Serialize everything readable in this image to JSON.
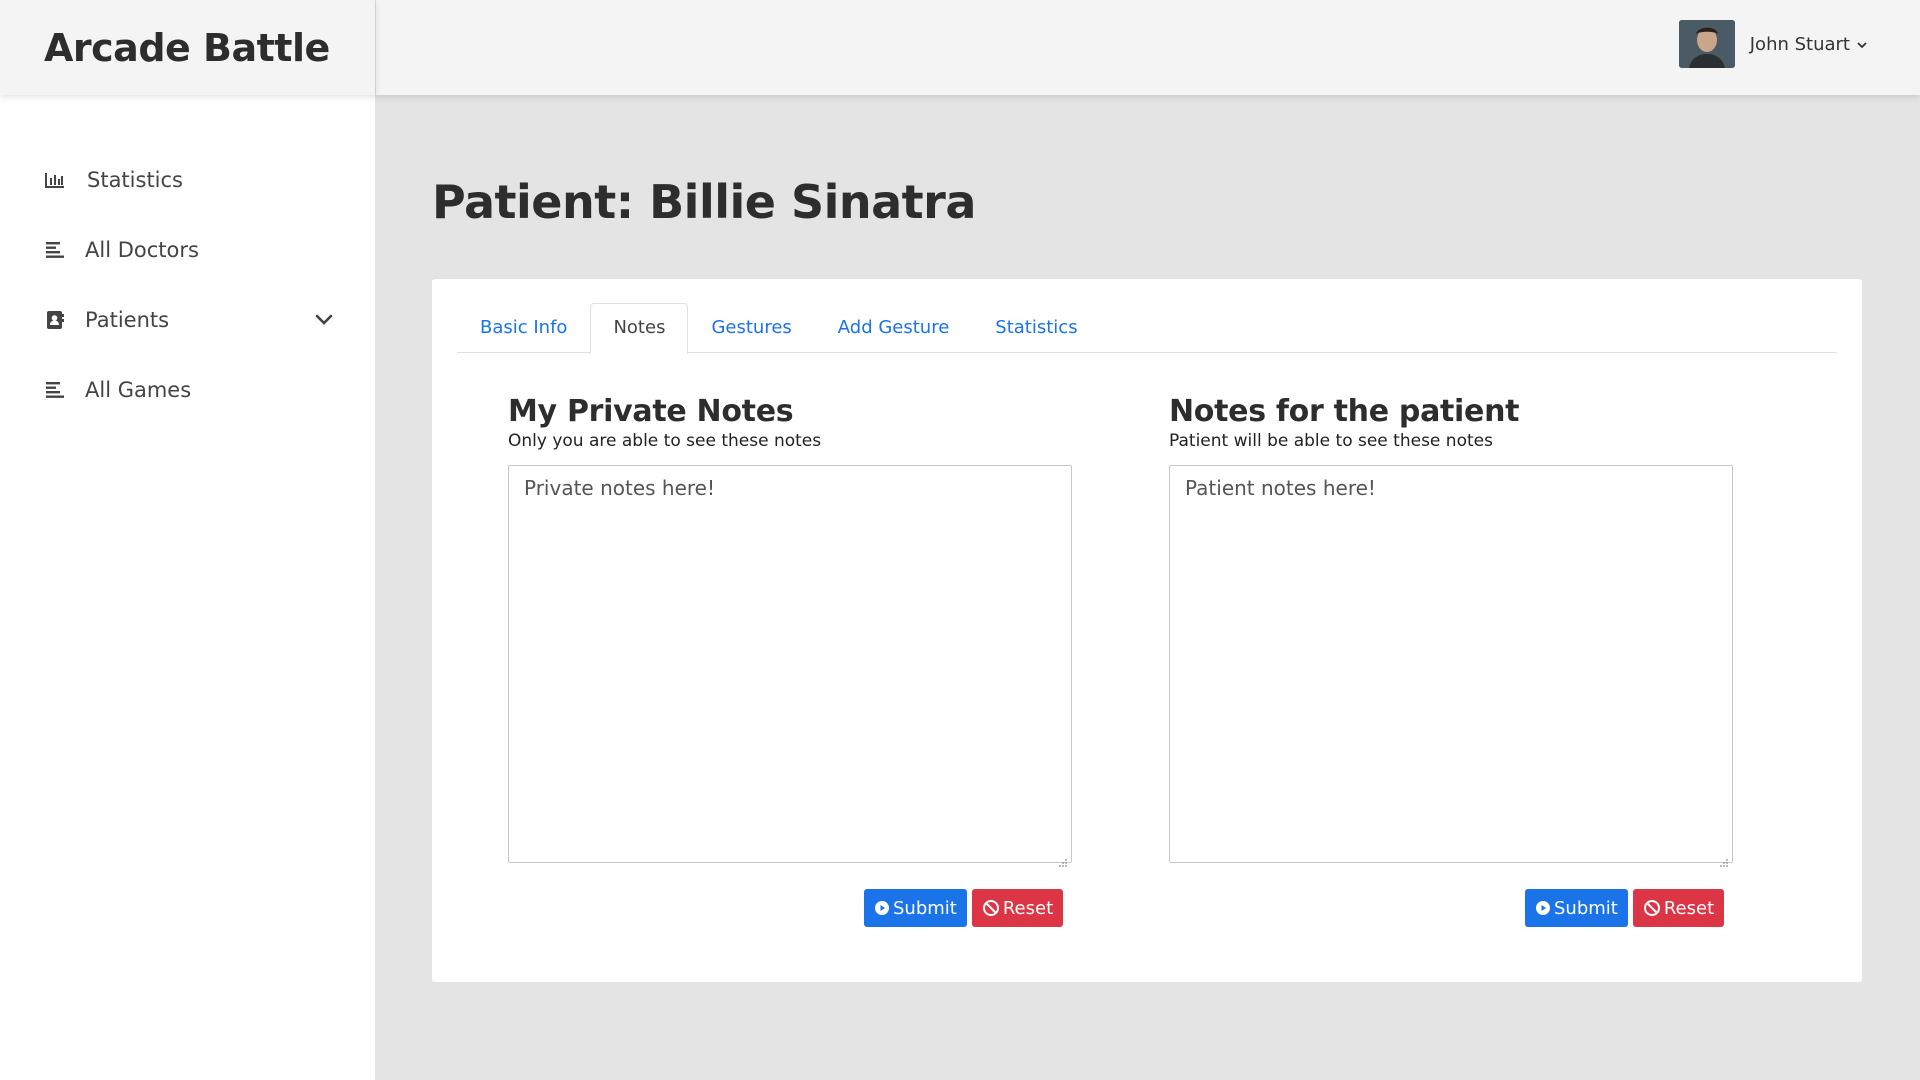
{
  "brand": {
    "title": "Arcade Battle"
  },
  "user": {
    "name": "John Stuart"
  },
  "sidebar": {
    "items": [
      {
        "label": "Statistics",
        "icon": "bar-chart-icon"
      },
      {
        "label": "All Doctors",
        "icon": "list-icon"
      },
      {
        "label": "Patients",
        "icon": "contact-book-icon"
      },
      {
        "label": "All Games",
        "icon": "list-icon"
      }
    ]
  },
  "page": {
    "title": "Patient: Billie Sinatra"
  },
  "tabs": [
    {
      "label": "Basic Info",
      "active": false
    },
    {
      "label": "Notes",
      "active": true
    },
    {
      "label": "Gestures",
      "active": false
    },
    {
      "label": "Add Gesture",
      "active": false
    },
    {
      "label": "Statistics",
      "active": false
    }
  ],
  "private_notes": {
    "title": "My Private Notes",
    "subtitle": "Only you are able to see these notes",
    "value": "Private notes here!",
    "submit_label": "Submit",
    "reset_label": "Reset"
  },
  "patient_notes": {
    "title": "Notes for the patient",
    "subtitle": "Patient will be able to see these notes",
    "value": "Patient notes here!",
    "submit_label": "Submit",
    "reset_label": "Reset"
  },
  "colors": {
    "primary": "#1a73e8",
    "danger": "#dc3545",
    "background": "#e4e4e4"
  }
}
